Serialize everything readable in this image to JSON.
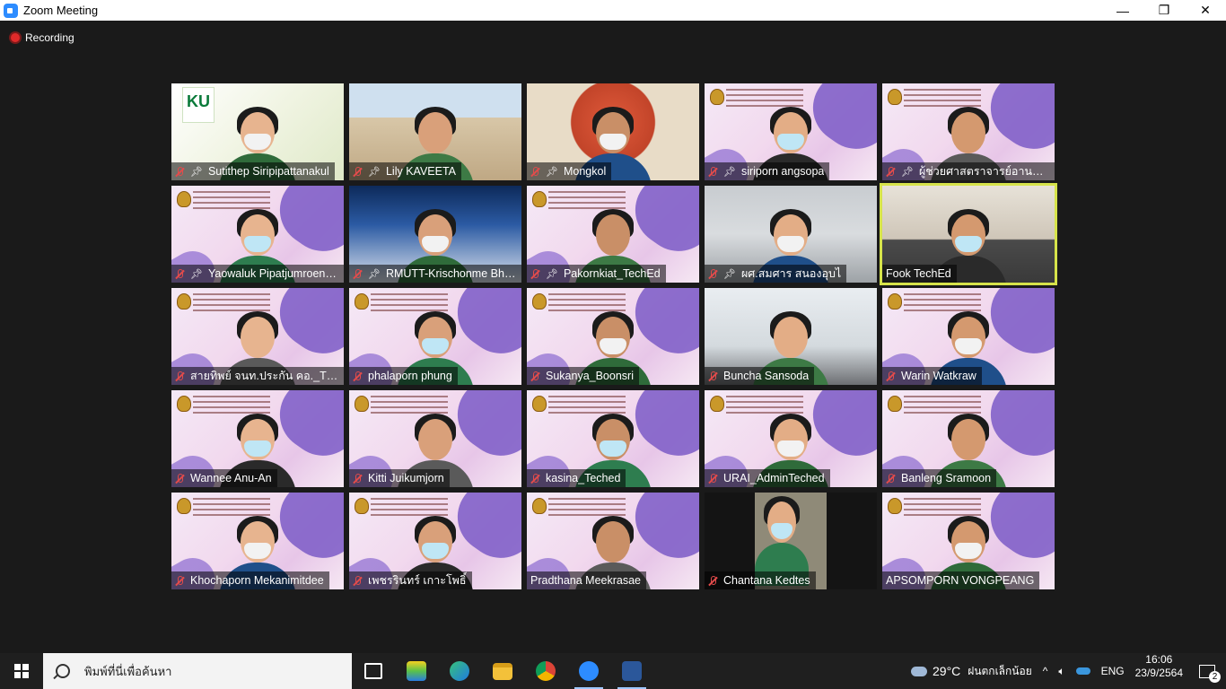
{
  "window": {
    "title": "Zoom Meeting",
    "minimize": "—",
    "restore": "❐",
    "close": "✕"
  },
  "meeting": {
    "recording_label": "Recording",
    "participants": [
      {
        "name": "Sutithep Siripipattanakul",
        "pinned": true,
        "muted": true,
        "bg": "ku"
      },
      {
        "name": "Lily KAVEETA",
        "pinned": true,
        "muted": true,
        "bg": "building"
      },
      {
        "name": "Mongkol",
        "pinned": true,
        "muted": true,
        "bg": "face"
      },
      {
        "name": "siriporn angsopa",
        "pinned": true,
        "muted": true,
        "bg": "banner"
      },
      {
        "name": "ผู้ช่วยศาสตราจารย์อานนท์ ...",
        "pinned": true,
        "muted": true,
        "bg": "banner"
      },
      {
        "name": "Yaowaluk Pipatjumroenk...",
        "pinned": true,
        "muted": true,
        "bg": "banner"
      },
      {
        "name": "RMUTT-Krischonme Bhumk...",
        "pinned": true,
        "muted": true,
        "bg": "blue"
      },
      {
        "name": "Pakornkiat_TechEd",
        "pinned": true,
        "muted": true,
        "bg": "banner"
      },
      {
        "name": "ผศ.สมศาร  สนองอุบไ",
        "pinned": true,
        "muted": true,
        "bg": "office"
      },
      {
        "name": "Fook TechEd",
        "pinned": false,
        "muted": false,
        "bg": "room",
        "active_speaker": true
      },
      {
        "name": "สายทิพย์ จนท.ประกัน คอ._TEC...",
        "pinned": false,
        "muted": true,
        "bg": "banner"
      },
      {
        "name": "phalaporn phung",
        "pinned": false,
        "muted": true,
        "bg": "banner"
      },
      {
        "name": "Sukanya_Boonsri",
        "pinned": false,
        "muted": true,
        "bg": "banner"
      },
      {
        "name": "Buncha Sansoda",
        "pinned": false,
        "muted": true,
        "bg": "class"
      },
      {
        "name": "Warin Watkraw",
        "pinned": false,
        "muted": true,
        "bg": "banner"
      },
      {
        "name": "Wannee Anu-An",
        "pinned": false,
        "muted": true,
        "bg": "banner"
      },
      {
        "name": "Kitti Juikumjorn",
        "pinned": false,
        "muted": true,
        "bg": "banner"
      },
      {
        "name": "kasina_Teched",
        "pinned": false,
        "muted": true,
        "bg": "banner"
      },
      {
        "name": "URAI_AdminTeched",
        "pinned": false,
        "muted": true,
        "bg": "banner"
      },
      {
        "name": "Banleng Sramoon",
        "pinned": false,
        "muted": true,
        "bg": "banner"
      },
      {
        "name": "Khochaporn Mekanimitdee",
        "pinned": false,
        "muted": true,
        "bg": "banner"
      },
      {
        "name": "เพชรรินทร์ เกาะโพธิ์",
        "pinned": false,
        "muted": true,
        "bg": "banner"
      },
      {
        "name": "Pradthana Meekrasae",
        "pinned": false,
        "muted": false,
        "bg": "banner"
      },
      {
        "name": "Chantana Kedtes",
        "pinned": false,
        "muted": true,
        "bg": "dark"
      },
      {
        "name": "APSOMPORN VONGPEANG",
        "pinned": false,
        "muted": false,
        "bg": "banner"
      }
    ]
  },
  "taskbar": {
    "search_placeholder": "พิมพ์ที่นี่เพื่อค้นหา",
    "apps": [
      "task-view-icon",
      "bluestacks-icon",
      "edge-icon",
      "file-explorer-icon",
      "chrome-icon",
      "zoom-icon",
      "word-icon"
    ],
    "weather": {
      "temp": "29°C",
      "desc": "ฝนตกเล็กน้อย"
    },
    "language": "ENG",
    "time": "16:06",
    "date": "23/9/2564",
    "notifications": "2"
  }
}
